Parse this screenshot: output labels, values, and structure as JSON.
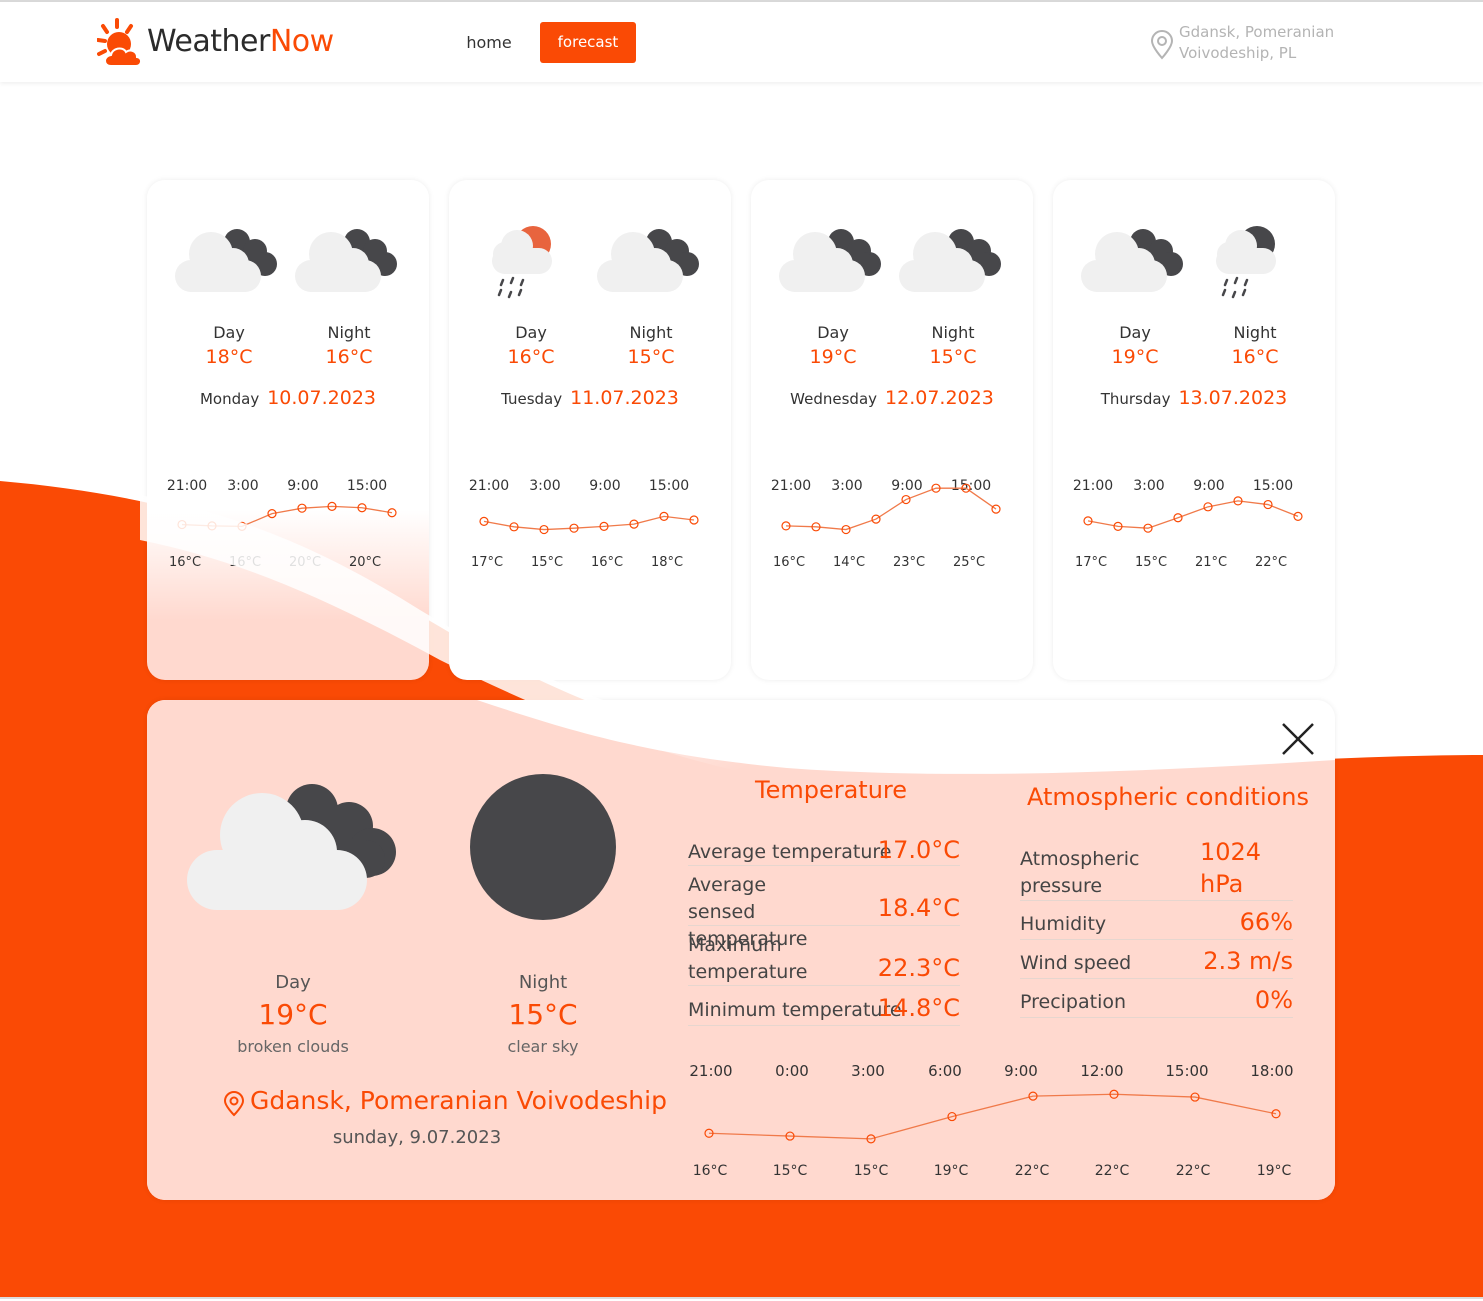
{
  "brand": {
    "name_a": "Weather",
    "name_b": "Now",
    "accent": "#fa4a05"
  },
  "nav": {
    "home": "home",
    "forecast": "forecast"
  },
  "header_location": {
    "line1": "Gdansk, Pomeranian",
    "line2": "Voivodeship, PL"
  },
  "cards": [
    {
      "day_icon": "cloud-broken-icon",
      "night_icon": "cloud-broken-icon",
      "day_label": "Day",
      "night_label": "Night",
      "day_temp": "18°C",
      "night_temp": "16°C",
      "weekday": "Monday",
      "date": "10.07.2023",
      "hours": [
        "21:00",
        "3:00",
        "9:00",
        "15:00"
      ],
      "temp_labels": [
        "16°C",
        "16°C",
        "20°C",
        "20°C"
      ],
      "values": [
        16.3,
        16.0,
        15.9,
        18.7,
        19.9,
        20.3,
        20.0,
        18.9
      ]
    },
    {
      "day_icon": "sun-cloud-rain-icon",
      "night_icon": "cloud-broken-icon",
      "day_label": "Day",
      "night_label": "Night",
      "day_temp": "16°C",
      "night_temp": "15°C",
      "weekday": "Tuesday",
      "date": "11.07.2023",
      "hours": [
        "21:00",
        "3:00",
        "9:00",
        "15:00"
      ],
      "temp_labels": [
        "17°C",
        "15°C",
        "16°C",
        "18°C"
      ],
      "values": [
        17.0,
        15.8,
        15.2,
        15.5,
        15.9,
        16.4,
        18.1,
        17.3
      ]
    },
    {
      "day_icon": "cloud-broken-icon",
      "night_icon": "cloud-broken-icon",
      "day_label": "Day",
      "night_label": "Night",
      "day_temp": "19°C",
      "night_temp": "15°C",
      "weekday": "Wednesday",
      "date": "12.07.2023",
      "hours": [
        "21:00",
        "3:00",
        "9:00",
        "15:00"
      ],
      "temp_labels": [
        "16°C",
        "14°C",
        "23°C",
        "25°C"
      ],
      "values": [
        16.0,
        15.8,
        15.2,
        17.5,
        21.8,
        24.3,
        24.3,
        19.7
      ]
    },
    {
      "day_icon": "cloud-broken-icon",
      "night_icon": "moon-cloud-rain-icon",
      "day_label": "Day",
      "night_label": "Night",
      "day_temp": "19°C",
      "night_temp": "16°C",
      "weekday": "Thursday",
      "date": "13.07.2023",
      "hours": [
        "21:00",
        "3:00",
        "9:00",
        "15:00"
      ],
      "temp_labels": [
        "17°C",
        "15°C",
        "21°C",
        "22°C"
      ],
      "values": [
        17.1,
        15.9,
        15.5,
        17.8,
        20.2,
        21.5,
        20.7,
        18.1
      ]
    }
  ],
  "detail": {
    "day_icon": "cloud-broken-icon",
    "night_icon": "clear-sky-night-icon",
    "day_label": "Day",
    "night_label": "Night",
    "day_temp": "19°C",
    "night_temp": "15°C",
    "day_desc": "broken clouds",
    "night_desc": "clear sky",
    "location": "Gdansk, Pomeranian Voivodeship",
    "date": "sunday, 9.07.2023",
    "temperature": {
      "title": "Temperature",
      "rows": [
        {
          "label": "Average temperature",
          "value": "17.0°C"
        },
        {
          "label": "Average sensed temperature",
          "value": "18.4°C"
        },
        {
          "label": "Maximum temperature",
          "value": "22.3°C"
        },
        {
          "label": "Minimum temperature",
          "value": "14.8°C"
        }
      ]
    },
    "atmospheric": {
      "title": "Atmospheric conditions",
      "rows": [
        {
          "label": "Atmospheric pressure",
          "value": "1024 hPa"
        },
        {
          "label": "Humidity",
          "value": "66%"
        },
        {
          "label": "Wind speed",
          "value": "2.3 m/s"
        },
        {
          "label": "Precipation",
          "value": "0%"
        }
      ]
    },
    "chart": {
      "hours": [
        "21:00",
        "0:00",
        "3:00",
        "6:00",
        "9:00",
        "12:00",
        "15:00",
        "18:00"
      ],
      "temp_labels": [
        "16°C",
        "15°C",
        "15°C",
        "19°C",
        "22°C",
        "22°C",
        "22°C",
        "19°C"
      ],
      "values": [
        15.8,
        15.5,
        15.2,
        17.6,
        19.8,
        20.0,
        19.7,
        17.9
      ]
    }
  },
  "colors": {
    "accent": "#fa4a05",
    "peach": "#ffd9cf",
    "cloud_dark": "#47474a",
    "cloud_light": "#f0f0f0",
    "sun": "#e8643e"
  }
}
